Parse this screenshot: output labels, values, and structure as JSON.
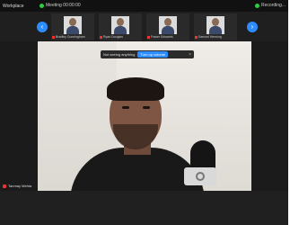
{
  "app": {
    "title": "Workplace"
  },
  "recording": {
    "label": "Meeting 00:00:00"
  },
  "status_right": {
    "label": "Recording..."
  },
  "thumbnails": [
    {
      "label": "Bradley Cunningham"
    },
    {
      "label": "Ryan Douglas"
    },
    {
      "label": "Fraser Edwards"
    },
    {
      "label": "Samuel Henning"
    }
  ],
  "nav": {
    "prev_icon": "chevron-left-icon",
    "next_icon": "chevron-right-icon",
    "prev_glyph": "‹",
    "next_glyph": "›"
  },
  "notice": {
    "text": "Not seeing anything",
    "button_label": "Turn up volume",
    "close_glyph": "×"
  },
  "main_video": {
    "participant_name": "Tanmay Mehta"
  },
  "colors": {
    "accent": "#2d8cff",
    "recording": "#2ecc40",
    "muted": "#e33333"
  }
}
